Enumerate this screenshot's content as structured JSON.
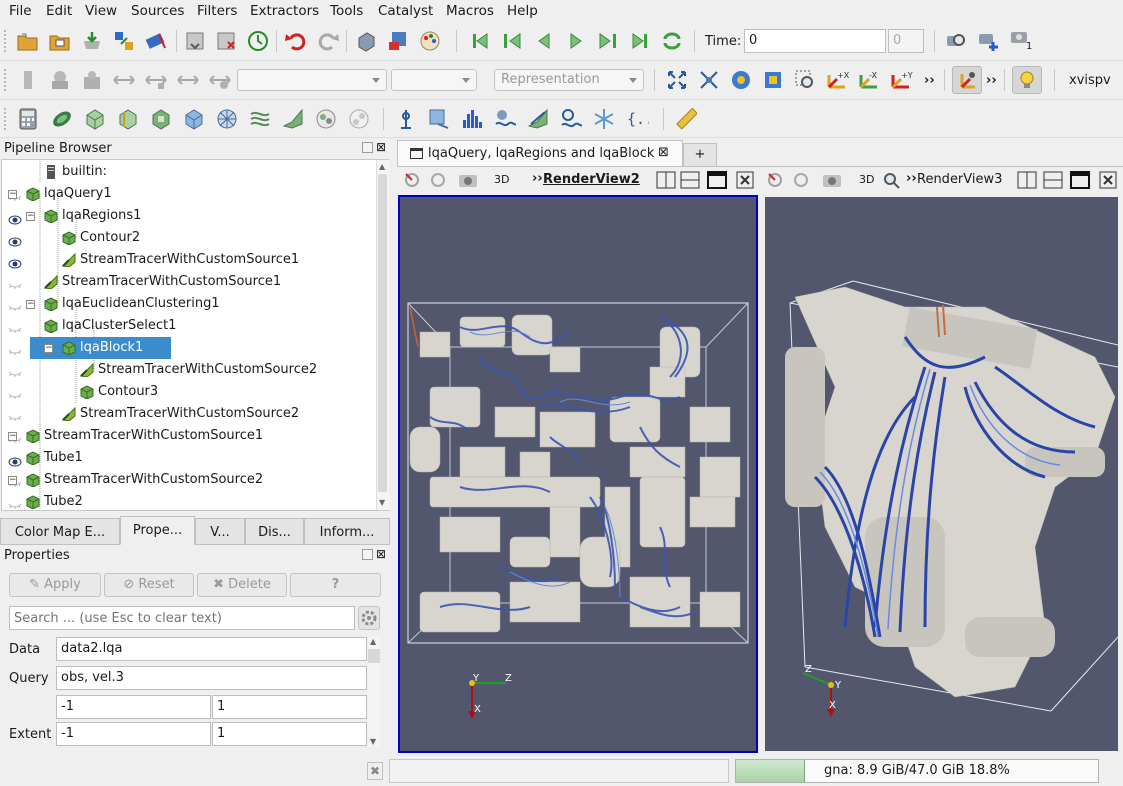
{
  "menu": [
    "File",
    "Edit",
    "View",
    "Sources",
    "Filters",
    "Extractors",
    "Tools",
    "Catalyst",
    "Macros",
    "Help"
  ],
  "toolbar1": {
    "time_label": "Time:",
    "time_value": "0",
    "time_index": "0",
    "camera_badge": "1"
  },
  "toolbar2": {
    "representation_placeholder": "Representation",
    "xvispv_label": "xvispv"
  },
  "pipeline": {
    "title": "Pipeline Browser",
    "items": [
      {
        "label": "builtin:",
        "eye": "none"
      },
      {
        "label": "lqaQuery1",
        "eye": "closed"
      },
      {
        "label": "lqaRegions1",
        "eye": "open"
      },
      {
        "label": "Contour2",
        "eye": "open"
      },
      {
        "label": "StreamTracerWithCustomSource1",
        "eye": "open"
      },
      {
        "label": "StreamTracerWithCustomSource1",
        "eye": "closed"
      },
      {
        "label": "lqaEuclideanClustering1",
        "eye": "closed"
      },
      {
        "label": "lqaClusterSelect1",
        "eye": "closed"
      },
      {
        "label": "lqaBlock1",
        "eye": "closed"
      },
      {
        "label": "StreamTracerWithCustomSource2",
        "eye": "closed"
      },
      {
        "label": "Contour3",
        "eye": "closed"
      },
      {
        "label": "StreamTracerWithCustomSource2",
        "eye": "closed"
      },
      {
        "label": "StreamTracerWithCustomSource1",
        "eye": "closed"
      },
      {
        "label": "Tube1",
        "eye": "open"
      },
      {
        "label": "StreamTracerWithCustomSource2",
        "eye": "closed"
      },
      {
        "label": "Tube2",
        "eye": "closed"
      }
    ]
  },
  "tabs": [
    "Color Map E...",
    "Prope...",
    "V...",
    "Dis...",
    "Inform..."
  ],
  "properties": {
    "title": "Properties",
    "apply": "Apply",
    "reset": "Reset",
    "delete": "Delete",
    "help": "?",
    "search_placeholder": "Search ... (use Esc to clear text)",
    "data_label": "Data",
    "data_value": "data2.lqa",
    "query_label": "Query",
    "query_value": "obs, vel.3",
    "row3_a": "-1",
    "row3_b": "1",
    "extent_label": "Extent",
    "extent_a": "-1",
    "extent_b": "1"
  },
  "layout_tab": {
    "title": "lqaQuery, lqaRegions and lqaBlock",
    "plus": "+"
  },
  "view2": {
    "mode": "3D",
    "name": "RenderView2"
  },
  "view3": {
    "mode": "3D",
    "name": "RenderView3"
  },
  "axes": {
    "y": "Y",
    "z": "Z",
    "x": "X"
  },
  "status": {
    "memory": "gna: 8.9 GiB/47.0 GiB 18.8%",
    "memory_fraction": 0.188
  },
  "colors": {
    "view_bg": "#52576e",
    "selection": "#3a8ccc",
    "active_border": "#0000c8"
  }
}
